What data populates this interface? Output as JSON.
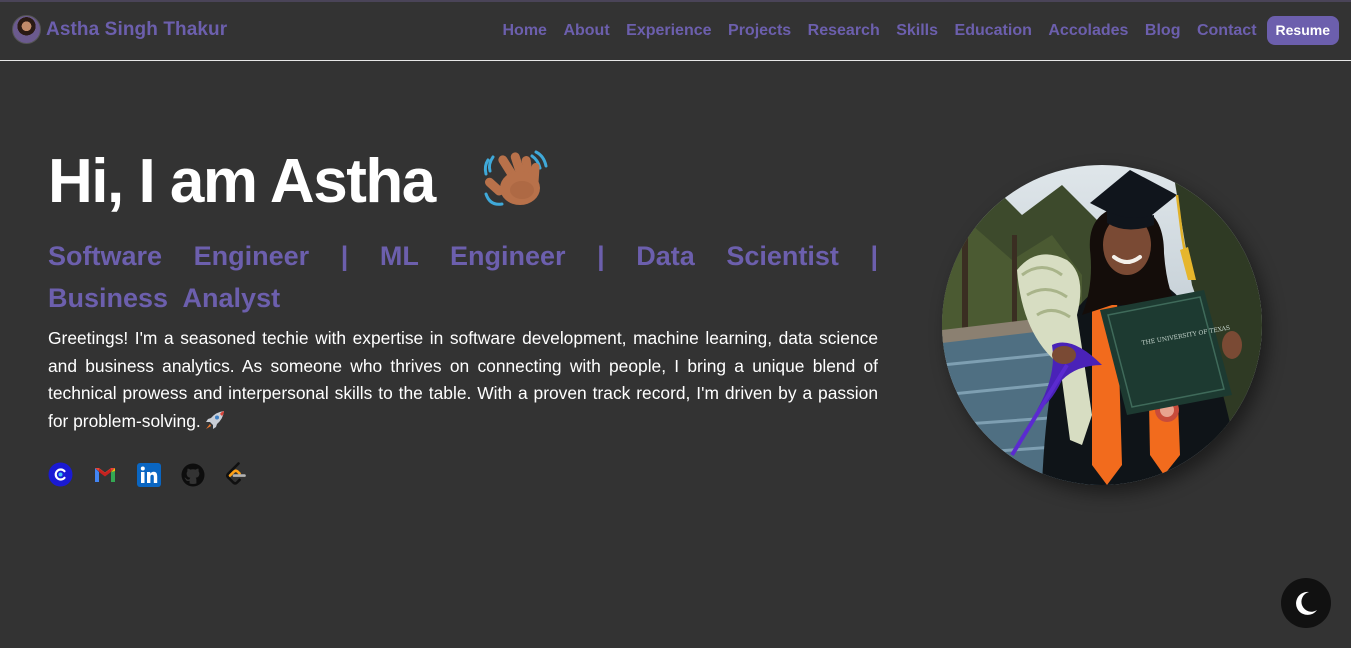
{
  "header": {
    "brand_name": "Astha Singh Thakur",
    "nav": [
      "Home",
      "About",
      "Experience",
      "Projects",
      "Research",
      "Skills",
      "Education",
      "Accolades",
      "Blog",
      "Contact"
    ],
    "resume_label": "Resume"
  },
  "hero": {
    "title": "Hi, I am Astha",
    "subtitle": "Software Engineer | ML Engineer | Data Scientist | Business Analyst",
    "bio": "Greetings! I'm a seasoned techie with expertise in software development, machine learning, data science and business analytics. As someone who thrives on connecting with people, I bring a unique blend of technical prowess and interpersonal skills to the table. With a proven track record, I'm driven by a passion for problem-solving."
  },
  "socials": [
    "calendly-icon",
    "gmail-icon",
    "linkedin-icon",
    "github-icon",
    "leetcode-icon"
  ],
  "colors": {
    "accent": "#6c5fad",
    "background": "#333333",
    "text": "#ffffff"
  }
}
